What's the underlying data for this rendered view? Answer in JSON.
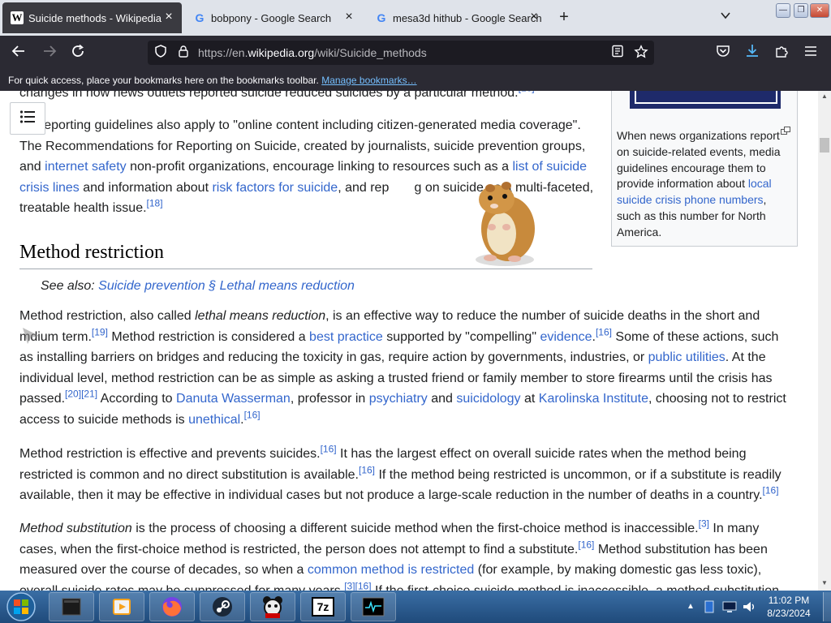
{
  "browser": {
    "tabs": [
      {
        "label": "Suicide methods - Wikipedia",
        "active": true,
        "favicon": "W"
      },
      {
        "label": "bobpony - Google Search",
        "active": false,
        "favicon": "G"
      },
      {
        "label": "mesa3d hithub - Google Search",
        "active": false,
        "favicon": "G"
      }
    ],
    "tab_close_glyph": "×",
    "new_tab_glyph": "+",
    "url_prefix": "https://en.",
    "url_host": "wikipedia.org",
    "url_path": "/wiki/Suicide_methods",
    "bookmarks_message": "For quick access, place your bookmarks here on the bookmarks toolbar.",
    "bookmarks_link": "Manage bookmarks…"
  },
  "article": {
    "top_cut_line": "changes in how news outlets reported suicide reduced suicides by a particular method.",
    "p1": {
      "t1": "ia reporting guidelines also apply to \"online content including citizen-generated media coverage\". The Recommendations for Reporting on Suicide, created by journalists, suicide prevention groups, and ",
      "l1": "internet safety",
      "t2": " non-profit organizations, encourage linking to resources such as a ",
      "l2": "list of suicide crisis lines",
      "t3": " and information about ",
      "l3": "risk factors for suicide",
      "t4": ", and rep",
      "t4b": "g on suicide as a multi-faceted, treatable health issue.",
      "s1": "[18]"
    },
    "section_title": "Method restriction",
    "hatnote_prefix": "See also: ",
    "hatnote_link": "Suicide prevention § Lethal means reduction",
    "p2": {
      "t1": "Method restriction, also called ",
      "e1": "lethal means reduction",
      "t2": ", is an effective way to reduce the number of suicide deaths in the short and m",
      "t2b": "dium term.",
      "s1": "[19]",
      "t3": " Method restriction is considered a ",
      "l1": "best practice",
      "t4": " supported by \"compelling\" ",
      "l2": "evidence",
      "t5": ".",
      "s2": "[16]",
      "t6": " Some of these actions, such as installing barriers on bridges and reducing the toxicity in gas, require action by governments, industries, or ",
      "l3": "public utilities",
      "t7": ". At the individual level, method restriction can be as simple as asking a trusted friend or family member to store firearms until the crisis has passed.",
      "s3": "[20]",
      "s4": "[21]",
      "t8": " According to ",
      "l4": "Danuta Wasserman",
      "t9": ", professor in ",
      "l5": "psychiatry",
      "t10": " and ",
      "l6": "suicidology",
      "t11": " at ",
      "l7": "Karolinska Institute",
      "t12": ", choosing not to restrict access to suicide methods is ",
      "l8": "unethical",
      "t13": ".",
      "s5": "[16]"
    },
    "p3": {
      "t1": "Method restriction is effective and prevents suicides.",
      "s1": "[16]",
      "t2": " It has the largest effect on overall suicide rates when the method being restricted is common and no direct substitution is available.",
      "s2": "[16]",
      "t3": " If the method being restricted is uncommon, or if a substitute is readily available, then it may be effective in individual cases but not produce a large-scale reduction in the number of deaths in a country.",
      "s3": "[16]"
    },
    "p4": {
      "e1": "Method substitution",
      "t1": " is the process of choosing a different suicide method when the first-choice method is inaccessible.",
      "s1": "[3]",
      "t2": " In many cases, when the first-choice method is restricted, the person does not attempt to find a substitute.",
      "s2": "[16]",
      "t3": " Method substitution has been measured over the course of decades, so when a ",
      "l1": "common method is restricted",
      "t4": " (for example, by making domestic gas less toxic), overall suicide rates may be suppressed for many years.",
      "s3": "[3]",
      "s4": "[16]",
      "t5": " If the first-choice suicide method is inaccessible, a method substitution"
    },
    "infobox": {
      "caption_t1": "When news organizations report on suicide-related events, media guidelines encourage them to provide information about ",
      "caption_link": "local suicide crisis phone numbers",
      "caption_t2": ", such as this number for North America."
    }
  },
  "taskbar": {
    "time": "11:02 PM",
    "date": "8/23/2024",
    "apps": [
      "start-orb",
      "notebook",
      "media-player",
      "firefox",
      "steam",
      "ucn",
      "7zip",
      "terminal"
    ],
    "app_7zip_label": "7z"
  },
  "colors": {
    "link": "#3366cc",
    "toolbar": "#2b2a33",
    "tabstrip": "#dfe3ea",
    "taskbar": "#2a5a8f"
  }
}
